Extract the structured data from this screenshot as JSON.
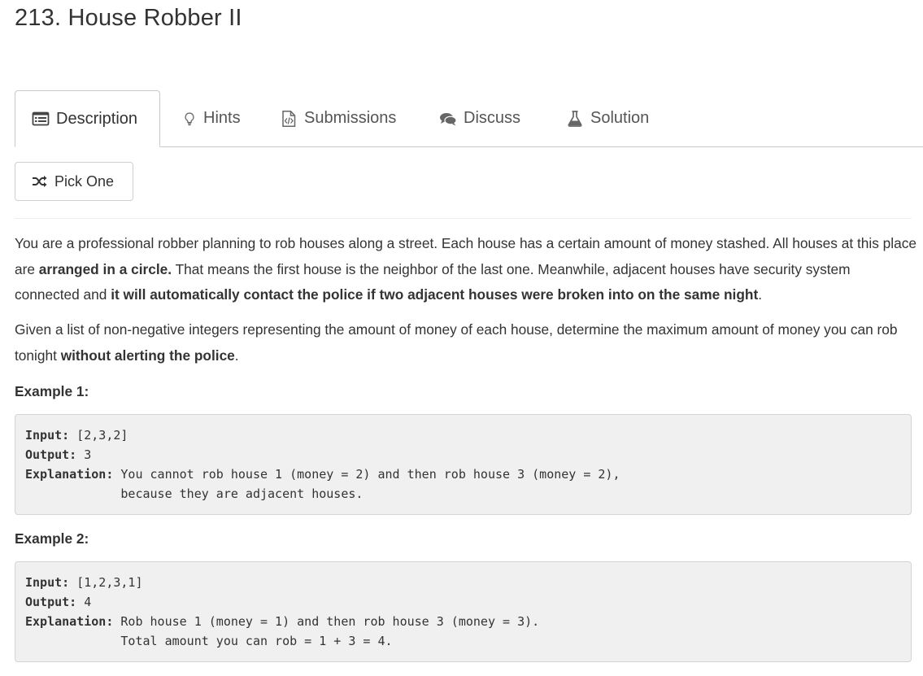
{
  "problem": {
    "title": "213. House Robber II"
  },
  "tabs": [
    {
      "label": "Description",
      "icon": "list-icon",
      "active": true
    },
    {
      "label": "Hints",
      "icon": "lightbulb-icon"
    },
    {
      "label": "Submissions",
      "icon": "code-file-icon"
    },
    {
      "label": "Discuss",
      "icon": "comments-icon"
    },
    {
      "label": "Solution",
      "icon": "flask-icon"
    }
  ],
  "pick_one": {
    "label": "Pick One",
    "icon": "shuffle-icon"
  },
  "description": {
    "p1_a": "You are a professional robber planning to rob houses along a street. Each house has a certain amount of money stashed. All houses at this place are ",
    "p1_b": "arranged in a circle.",
    "p1_c": " That means the first house is the neighbor of the last one. Meanwhile, adjacent houses have security system connected and ",
    "p1_d": "it will automatically contact the police if two adjacent houses were broken into on the same night",
    "p1_e": ".",
    "p2_a": "Given a list of non-negative integers representing the amount of money of each house, determine the maximum amount of money you can rob tonight ",
    "p2_b": "without alerting the police",
    "p2_c": "."
  },
  "examples": [
    {
      "heading": "Example 1:",
      "input_label": "Input:",
      "input": " [2,3,2]",
      "output_label": "Output:",
      "output": " 3",
      "explanation_label": "Explanation:",
      "explanation_1": " You cannot rob house 1 (money = 2) and then rob house 3 (money = 2),",
      "explanation_2": "             because they are adjacent houses."
    },
    {
      "heading": "Example 2:",
      "input_label": "Input:",
      "input": " [1,2,3,1]",
      "output_label": "Output:",
      "output": " 4",
      "explanation_label": "Explanation:",
      "explanation_1": " Rob house 1 (money = 1) and then rob house 3 (money = 3).",
      "explanation_2": "             Total amount you can rob = 1 + 3 = 4."
    }
  ],
  "colors": {
    "text": "#333333",
    "tab_text": "#555555",
    "border": "#c9c9c9",
    "code_bg": "#f0f0f0"
  }
}
